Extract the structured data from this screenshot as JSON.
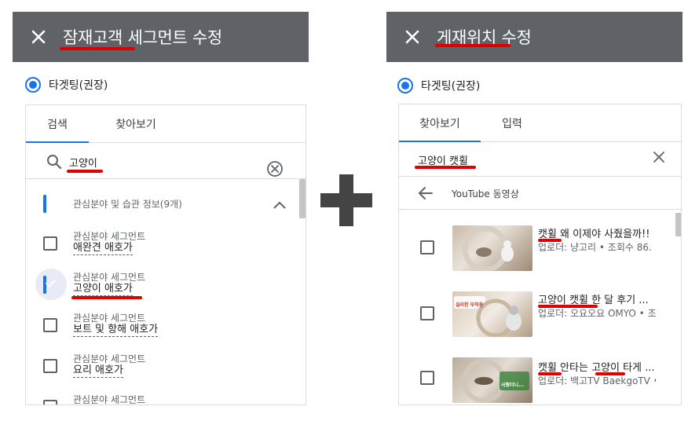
{
  "left_panel": {
    "title": "잠재고객 세그먼트 수정",
    "radio_label": "타겟팅(권장)",
    "tabs": [
      {
        "label": "검색"
      },
      {
        "label": "찾아보기"
      }
    ],
    "search_value": "고양이",
    "group": {
      "label": "관심분야 및 습관 정보(9개)"
    },
    "items": [
      {
        "category": "관심분야 세그먼트",
        "name": "애완견 애호가",
        "checked": false
      },
      {
        "category": "관심분야 세그먼트",
        "name": "고양이 애호가",
        "checked": true
      },
      {
        "category": "관심분야 세그먼트",
        "name": "보트 및 항해 애호가",
        "checked": false
      },
      {
        "category": "관심분야 세그먼트",
        "name": "요리 애호가",
        "checked": false
      },
      {
        "category": "관심분야 세그먼트",
        "name": "",
        "checked": false
      }
    ]
  },
  "right_panel": {
    "title": "게재위치 수정",
    "radio_label": "타겟팅(권장)",
    "tabs": [
      {
        "label": "찾아보기"
      },
      {
        "label": "입력"
      }
    ],
    "search_value": "고양이 캣휠",
    "back_label": "YouTube 동영상",
    "videos": [
      {
        "title": "캣휠 왜 이제야 사줬을까!!",
        "meta": "업로더: 냥고리 • 조회수 86.",
        "thumb_text": ""
      },
      {
        "title": "고양이 캣휠 한 달 후기 ...",
        "meta": "업로더: 오요오요 OMYO • 조",
        "thumb_text": "실리한 부작용"
      },
      {
        "title": "캣휠 안타는 고양이 타게 ...",
        "meta": "업로더: 백고TV BaekgoTV •",
        "thumb_text": "사줬더니..."
      }
    ]
  },
  "colors": {
    "header_bg": "#5f6266",
    "accent": "#1a73e8",
    "highlight": "#e00000",
    "plus": "#444444"
  }
}
